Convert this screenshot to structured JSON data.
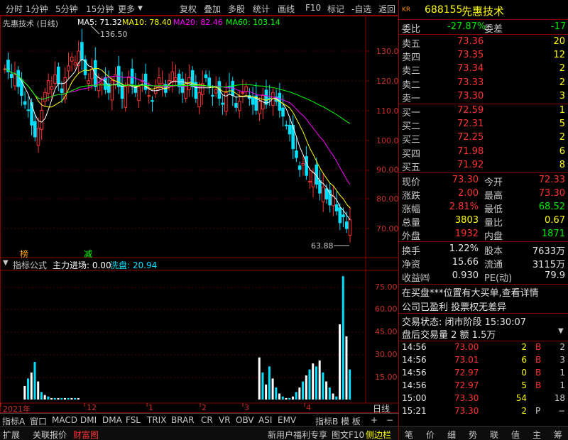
{
  "toolbar": {
    "items": [
      "分时",
      "1分钟",
      "5分钟",
      "15分钟",
      "更多",
      "复权",
      "叠加",
      "多股",
      "统计",
      "画线",
      "F10",
      "标记",
      "-自选",
      "返回"
    ]
  },
  "chart_header": {
    "title": "先惠技术 (日线)",
    "ma5": "MA5: 71.32",
    "ma10": "MA10: 78.40",
    "ma20": "MA20: 82.46",
    "ma60": "MA60: 103.14",
    "high_marker": "136.50",
    "low_marker": "63.88",
    "tag1": "榜",
    "tag2": "减"
  },
  "indicator_header": {
    "label": "指标公式",
    "main": "主力进场: 0.00",
    "xp": "洗盘: 20.94"
  },
  "colors": {
    "up": "#ff3232",
    "down": "#00e0ff",
    "ma5": "#ffffff",
    "ma10": "#ffff00",
    "ma20": "#ff00ff",
    "ma60": "#00ff00",
    "frame": "#8b0000"
  },
  "price_axis": [
    "130.0",
    "120.0",
    "110.0",
    "100.0",
    "90.00",
    "80.00",
    "70.00"
  ],
  "ind_axis": [
    "75.00",
    "60.00",
    "45.00",
    "30.00",
    "15.00"
  ],
  "date_axis": [
    "2021年",
    "12",
    "1",
    "2",
    "3",
    "4"
  ],
  "date_mode": "日线",
  "bottom_tabs": [
    "指标A",
    "窗口",
    "MACD",
    "DMI",
    "DMA",
    "FSL",
    "TRIX",
    "BRAR",
    "CR",
    "VR",
    "OBV",
    "ASI",
    "EMV",
    "指标B",
    "模 板",
    "+",
    "−"
  ],
  "status_bar": [
    "扩展",
    "关联报价",
    "财富图",
    "新用户福利专享",
    "图文F10",
    "侧边栏"
  ],
  "right_bottom": [
    "笔",
    "价",
    "细",
    "势",
    "联",
    "值",
    "主",
    "筹"
  ],
  "stock": {
    "code": "688155",
    "name": "先惠技术",
    "prefix": "KR"
  },
  "weibi": {
    "label": "委比",
    "value": "-27.87%",
    "label2": "委差",
    "value2": "-17"
  },
  "asks": [
    {
      "label": "卖五",
      "price": "73.36",
      "vol": "20"
    },
    {
      "label": "卖四",
      "price": "73.35",
      "vol": "12"
    },
    {
      "label": "卖三",
      "price": "73.34",
      "vol": "2"
    },
    {
      "label": "卖二",
      "price": "73.33",
      "vol": "2"
    },
    {
      "label": "卖一",
      "price": "73.30",
      "vol": "3"
    }
  ],
  "bids": [
    {
      "label": "买一",
      "price": "72.59",
      "vol": "1"
    },
    {
      "label": "买二",
      "price": "72.31",
      "vol": "5"
    },
    {
      "label": "买三",
      "price": "72.25",
      "vol": "2"
    },
    {
      "label": "买四",
      "price": "71.98",
      "vol": "6"
    },
    {
      "label": "买五",
      "price": "71.92",
      "vol": "8"
    }
  ],
  "quote": [
    {
      "l1": "现价",
      "v1": "73.30",
      "c1": "red",
      "l2": "今开",
      "v2": "72.33",
      "c2": "red"
    },
    {
      "l1": "涨跌",
      "v1": "2.00",
      "c1": "red",
      "l2": "最高",
      "v2": "73.30",
      "c2": "red"
    },
    {
      "l1": "涨幅",
      "v1": "2.81%",
      "c1": "red",
      "l2": "最低",
      "v2": "68.52",
      "c2": "green"
    },
    {
      "l1": "总量",
      "v1": "3803",
      "c1": "yellow",
      "l2": "量比",
      "v2": "0.67",
      "c2": "yellow"
    },
    {
      "l1": "外盘",
      "v1": "1932",
      "c1": "red",
      "l2": "内盘",
      "v2": "1871",
      "c2": "green"
    }
  ],
  "fund": [
    {
      "l1": "换手",
      "v1": "1.22%",
      "l2": "股本",
      "v2": "7633万"
    },
    {
      "l1": "净资",
      "v1": "15.66",
      "l2": "流通",
      "v2": "3115万"
    },
    {
      "l1": "收益㈣",
      "v1": "0.930",
      "l2": "PE(动)",
      "v2": "79.9"
    }
  ],
  "news": [
    "在买盘***位置有大买单,查看详情",
    "公司已盈利 投票权无差异"
  ],
  "trade_status": {
    "line1": "交易状态: 闭市阶段 15:30:07",
    "line2": "盘后交易量 2 额 1.5万"
  },
  "ticks": [
    {
      "time": "14:56",
      "price": "73.00",
      "vol": "2",
      "side": "B",
      "n": "2"
    },
    {
      "time": "14:56",
      "price": "73.01",
      "vol": "6",
      "side": "B",
      "n": "3"
    },
    {
      "time": "14:56",
      "price": "72.97",
      "vol": "0",
      "side": "B",
      "n": "1"
    },
    {
      "time": "14:56",
      "price": "72.97",
      "vol": "5",
      "side": "B",
      "n": "1"
    },
    {
      "time": "15:00",
      "price": "73.30",
      "vol": "54",
      "side": "",
      "n": "18"
    },
    {
      "time": "15:21",
      "price": "73.30",
      "vol": "2",
      "side": "P",
      "n": "−"
    }
  ]
}
